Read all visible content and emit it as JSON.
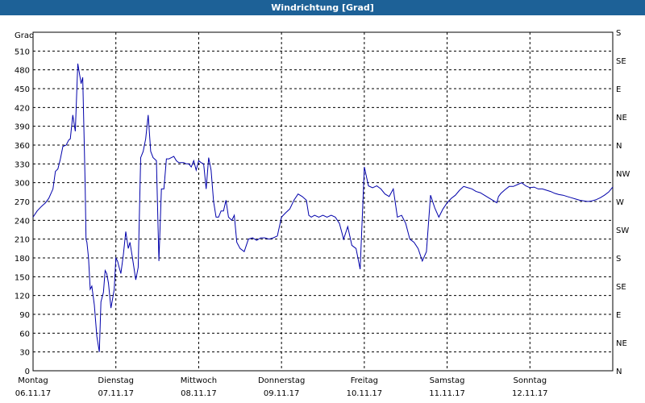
{
  "chart_data": {
    "type": "line",
    "title": "Windrichtung [Grad]",
    "ylabel": "Grad",
    "ylim": [
      0,
      540
    ],
    "yticks": [
      0,
      30,
      60,
      90,
      120,
      150,
      180,
      210,
      240,
      270,
      300,
      330,
      360,
      390,
      420,
      450,
      480,
      510
    ],
    "right_axis_labels": [
      "N",
      "NE",
      "E",
      "SE",
      "S",
      "SW",
      "W",
      "NW",
      "N",
      "NE",
      "E",
      "SE",
      "S"
    ],
    "grid": true,
    "x_categories": [
      {
        "day": "Montag",
        "date": "06.11.17"
      },
      {
        "day": "Dienstag",
        "date": "07.11.17"
      },
      {
        "day": "Mittwoch",
        "date": "08.11.17"
      },
      {
        "day": "Donnerstag",
        "date": "09.11.17"
      },
      {
        "day": "Freitag",
        "date": "10.11.17"
      },
      {
        "day": "Samstag",
        "date": "11.11.17"
      },
      {
        "day": "Sonntag",
        "date": "12.11.17"
      }
    ],
    "series": [
      {
        "color": "#0000aa",
        "x": [
          0.0,
          0.05,
          0.1,
          0.15,
          0.19,
          0.24,
          0.27,
          0.3,
          0.33,
          0.36,
          0.4,
          0.43,
          0.45,
          0.48,
          0.51,
          0.54,
          0.58,
          0.6,
          0.62,
          0.63,
          0.64,
          0.65,
          0.67,
          0.69,
          0.71,
          0.74,
          0.77,
          0.8,
          0.82,
          0.85,
          0.87,
          0.89,
          0.91,
          0.94,
          0.98,
          1.0,
          1.02,
          1.04,
          1.06,
          1.09,
          1.12,
          1.15,
          1.17,
          1.2,
          1.24,
          1.27,
          1.3,
          1.33,
          1.36,
          1.39,
          1.42,
          1.45,
          1.49,
          1.52,
          1.55,
          1.58,
          1.61,
          1.64,
          1.67,
          1.7,
          1.73,
          1.76,
          1.79,
          1.82,
          1.85,
          1.88,
          1.91,
          1.94,
          1.97,
          2.0,
          2.03,
          2.06,
          2.09,
          2.12,
          2.15,
          2.18,
          2.21,
          2.24,
          2.27,
          2.3,
          2.33,
          2.36,
          2.4,
          2.43,
          2.46,
          2.5,
          2.55,
          2.6,
          2.65,
          2.7,
          2.75,
          2.8,
          2.85,
          2.9,
          2.95,
          3.0,
          3.05,
          3.1,
          3.15,
          3.2,
          3.25,
          3.3,
          3.33,
          3.36,
          3.4,
          3.45,
          3.5,
          3.55,
          3.6,
          3.65,
          3.7,
          3.75,
          3.8,
          3.85,
          3.9,
          3.95,
          4.0,
          4.05,
          4.1,
          4.15,
          4.2,
          4.25,
          4.3,
          4.35,
          4.4,
          4.45,
          4.5,
          4.55,
          4.6,
          4.65,
          4.7,
          4.75,
          4.8,
          4.85,
          4.9,
          4.95,
          5.0,
          5.05,
          5.1,
          5.15,
          5.2,
          5.25,
          5.3,
          5.35,
          5.4,
          5.45,
          5.5,
          5.55,
          5.6,
          5.62,
          5.65,
          5.7,
          5.75,
          5.8,
          5.85,
          5.9,
          5.95,
          6.0,
          6.05,
          6.1,
          6.15,
          6.2,
          6.25,
          6.3,
          6.35,
          6.4,
          6.45,
          6.5,
          6.55,
          6.6,
          6.65,
          6.7,
          6.75,
          6.8,
          6.85,
          6.9,
          6.95,
          7.0
        ],
        "values": [
          245,
          255,
          262,
          268,
          275,
          290,
          318,
          322,
          338,
          358,
          360,
          368,
          370,
          408,
          382,
          490,
          458,
          468,
          350,
          290,
          210,
          205,
          180,
          130,
          135,
          105,
          55,
          30,
          110,
          125,
          160,
          155,
          140,
          100,
          130,
          180,
          175,
          165,
          155,
          185,
          222,
          195,
          205,
          180,
          145,
          165,
          340,
          350,
          370,
          408,
          350,
          340,
          335,
          175,
          290,
          290,
          338,
          338,
          340,
          342,
          335,
          332,
          332,
          332,
          330,
          330,
          325,
          335,
          320,
          335,
          332,
          330,
          290,
          340,
          320,
          270,
          245,
          245,
          255,
          255,
          272,
          245,
          240,
          248,
          205,
          195,
          190,
          210,
          212,
          208,
          212,
          212,
          210,
          212,
          215,
          245,
          252,
          258,
          272,
          282,
          278,
          272,
          248,
          245,
          248,
          245,
          248,
          245,
          248,
          245,
          235,
          210,
          230,
          200,
          195,
          162,
          325,
          295,
          292,
          295,
          290,
          282,
          278,
          290,
          245,
          248,
          235,
          210,
          205,
          195,
          175,
          190,
          280,
          260,
          245,
          258,
          268,
          275,
          280,
          288,
          294,
          292,
          290,
          286,
          284,
          280,
          276,
          272,
          268,
          278,
          283,
          289,
          294,
          294,
          297,
          300,
          295,
          292,
          293,
          290,
          290,
          288,
          286,
          283,
          281,
          280,
          278,
          276,
          274,
          272,
          271,
          270,
          271,
          273,
          276,
          280,
          285,
          293
        ]
      }
    ]
  }
}
